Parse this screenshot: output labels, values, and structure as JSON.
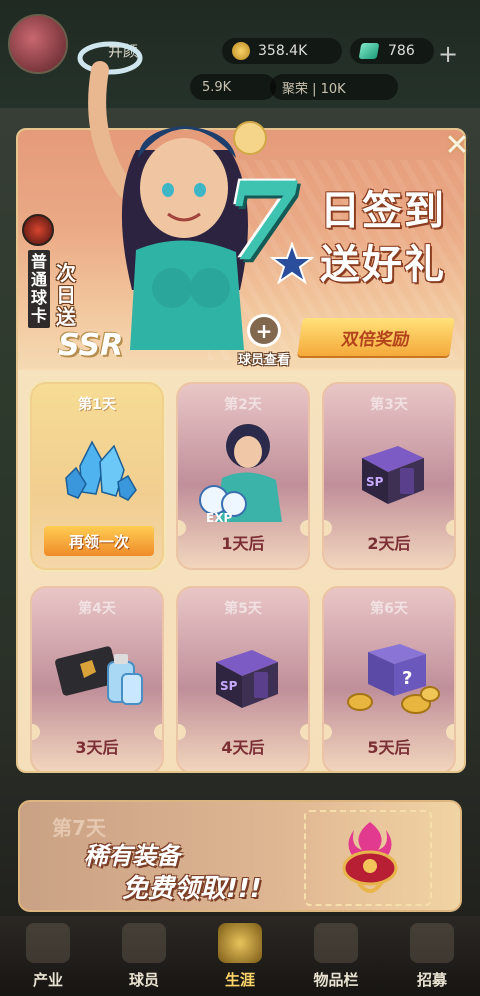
{
  "hud": {
    "player_name": "井颜",
    "gold": "358.4K",
    "gems": "786",
    "plus": "+",
    "power": "5.9K",
    "rank": "聚荣 | 10K"
  },
  "popup": {
    "title_number": "7",
    "title_line1": "日签到",
    "title_line2": "送好礼",
    "double_reward": "双倍奖励",
    "inspect_label": "球员查看",
    "scout_card_label": "普通球卡",
    "next_day_label": "次日送",
    "rarity": "SSR",
    "close_symbol": "✕"
  },
  "days": [
    {
      "label": "第1天",
      "state": "claimed",
      "action": "再领一次",
      "reward_icon": "crystal-cluster-icon"
    },
    {
      "label": "第2天",
      "state": "locked",
      "status": "1天后",
      "reward_icon": "player-card-exp-icon"
    },
    {
      "label": "第3天",
      "state": "locked",
      "status": "2天后",
      "reward_icon": "sp-box-icon"
    },
    {
      "label": "第4天",
      "state": "locked",
      "status": "3天后",
      "reward_icon": "card-and-potion-icon"
    },
    {
      "label": "第5天",
      "state": "locked",
      "status": "4天后",
      "reward_icon": "sp-box-icon"
    },
    {
      "label": "第6天",
      "state": "locked",
      "status": "5天后",
      "reward_icon": "mystery-box-coins-icon"
    }
  ],
  "day7": {
    "label": "第7天",
    "line1": "稀有装备",
    "line2": "免费领取!!!",
    "reward_icon": "rare-equipment-icon"
  },
  "nav": [
    {
      "label": "产业",
      "icon": "industry-icon"
    },
    {
      "label": "球员",
      "icon": "players-icon"
    },
    {
      "label": "生涯",
      "icon": "career-icon",
      "active": true
    },
    {
      "label": "物品栏",
      "icon": "inventory-icon"
    },
    {
      "label": "招募",
      "icon": "recruit-icon"
    }
  ],
  "colors": {
    "accent_teal": "#3ec3b1",
    "claim_orange": "#ef8b2a",
    "status_text": "#7b2f35"
  }
}
